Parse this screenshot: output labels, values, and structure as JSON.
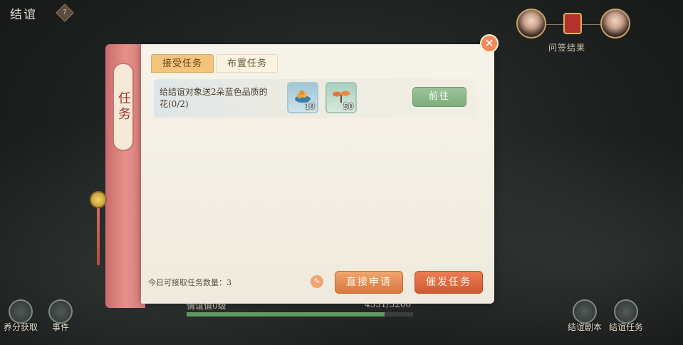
{
  "header": {
    "title": "结谊",
    "help_badge": "?"
  },
  "top_right": {
    "sign_label": "问签结果"
  },
  "panel": {
    "spine_label": "任务",
    "close_symbol": "✕",
    "tabs": [
      {
        "label": "接受任务",
        "active": true
      },
      {
        "label": "布置任务",
        "active": false
      }
    ],
    "tasks": [
      {
        "description": "给结谊对象送2朵蓝色品质的花(0/2)",
        "rewards": [
          {
            "icon": "food-bowl-icon",
            "quantity": "10"
          },
          {
            "icon": "sprout-icon",
            "quantity": "50"
          }
        ],
        "go_label": "前往"
      }
    ],
    "footer": {
      "accept_limit_label": "今日可接取任务数量：3",
      "edit_icon": "✎",
      "apply_label": "直接申请",
      "publish_label": "催发任务"
    }
  },
  "background": {
    "progress_label": "情谊值0级",
    "progress_value": "4551/5200",
    "progress_fraction": 0.875,
    "bottom_left_buttons": [
      {
        "label": "养分获取"
      },
      {
        "label": "事件"
      }
    ],
    "bottom_right_buttons": [
      {
        "label": "结谊剧本"
      },
      {
        "label": "结谊任务"
      }
    ]
  },
  "colors": {
    "spine": "#e7908b",
    "tab_active": "#f2c47c",
    "go_button": "#8fba8d",
    "apply_button": "#e58e55",
    "publish_button": "#de6b43"
  }
}
